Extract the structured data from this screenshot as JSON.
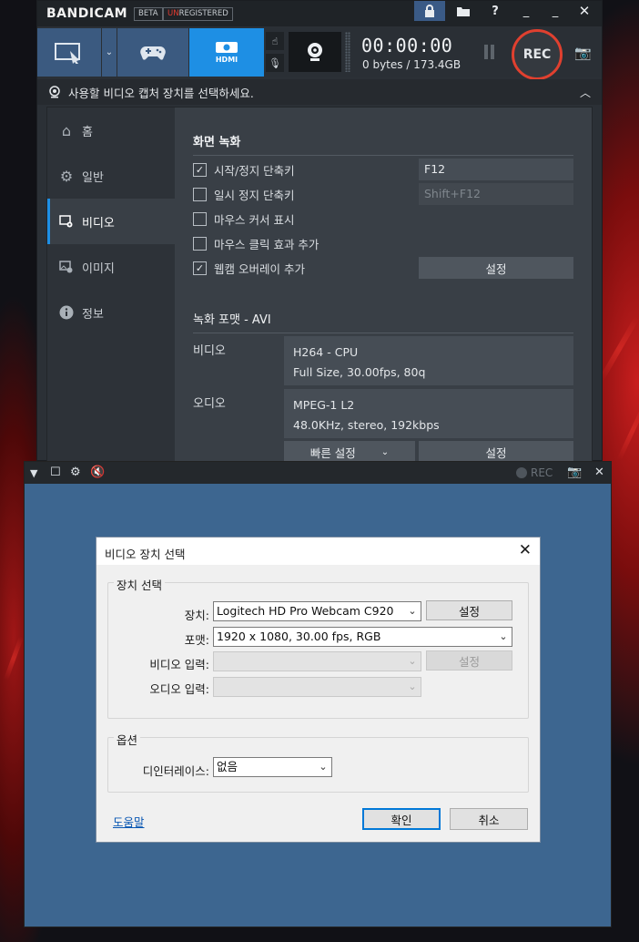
{
  "app": {
    "logo": "BANDICAM",
    "beta_badge": "BETA",
    "unreg_prefix": "UN",
    "unreg_rest": "REGISTERED"
  },
  "toolbar": {
    "timer": "00:00:00",
    "size": "0 bytes / 173.4GB",
    "rec_label": "REC",
    "hdmi_label": "HDMI"
  },
  "hint": "사용할 비디오 캡처 장치를 선택하세요.",
  "sidebar": {
    "items": [
      {
        "label": "홈",
        "icon": "home-icon"
      },
      {
        "label": "일반",
        "icon": "gear-icon"
      },
      {
        "label": "비디오",
        "icon": "video-settings-icon"
      },
      {
        "label": "이미지",
        "icon": "image-settings-icon"
      },
      {
        "label": "정보",
        "icon": "info-icon"
      }
    ],
    "active": "비디오"
  },
  "screen_rec": {
    "title": "화면 녹화",
    "options": [
      {
        "label": "시작/정지 단축키",
        "checked": true
      },
      {
        "label": "일시 정지 단축키",
        "checked": false
      },
      {
        "label": "마우스 커서 표시",
        "checked": false
      },
      {
        "label": "마우스 클릭 효과 추가",
        "checked": false
      },
      {
        "label": "웹캠 오버레이 추가",
        "checked": true
      }
    ],
    "hotkey_start": "F12",
    "hotkey_pause": "Shift+F12",
    "webcam_settings": "설정"
  },
  "format": {
    "title": "녹화 포맷 - AVI",
    "video_label": "비디오",
    "video_line1": "H264 - CPU",
    "video_line2": "Full Size, 30.00fps, 80q",
    "audio_label": "오디오",
    "audio_line1": "MPEG-1 L2",
    "audio_line2": "48.0KHz, stereo, 192kbps",
    "quick_btn": "빠른 설정",
    "settings_btn": "설정"
  },
  "preview": {
    "rec_label": "REC"
  },
  "dialog": {
    "title": "비디오 장치 선택",
    "device_group": "장치 선택",
    "device_label": "장치:",
    "device_value": "Logitech HD Pro Webcam C920",
    "device_settings": "설정",
    "format_label": "포맷:",
    "format_value": "1920 x 1080, 30.00 fps, RGB",
    "video_in_label": "비디오 입력:",
    "video_in_settings": "설정",
    "audio_in_label": "오디오 입력:",
    "options_group": "옵션",
    "deinterlace_label": "디인터레이스:",
    "deinterlace_value": "없음",
    "help_link": "도움말",
    "ok": "확인",
    "cancel": "취소"
  },
  "colors": {
    "accent": "#1e8fe4",
    "rec_ring": "#e0402f",
    "preview_bg": "#3d6690"
  }
}
